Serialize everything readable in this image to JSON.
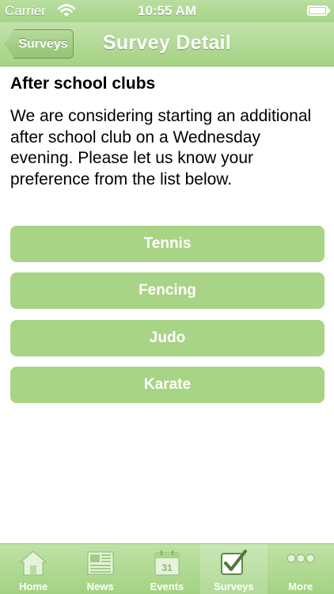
{
  "status_bar": {
    "carrier": "Carrier",
    "time": "10:55 AM"
  },
  "nav": {
    "back_label": "Surveys",
    "title": "Survey Detail"
  },
  "survey": {
    "title": "After school clubs",
    "description": "We are considering starting an additional after school club on a Wednesday evening. Please let us know your preference from the list below.",
    "options": [
      {
        "label": "Tennis"
      },
      {
        "label": "Fencing"
      },
      {
        "label": "Judo"
      },
      {
        "label": "Karate"
      }
    ]
  },
  "tab_bar": {
    "items": [
      {
        "label": "Home",
        "icon": "home-icon"
      },
      {
        "label": "News",
        "icon": "news-icon"
      },
      {
        "label": "Events",
        "icon": "calendar-icon",
        "icon_text": "31"
      },
      {
        "label": "Surveys",
        "icon": "checkbox-icon",
        "selected": true
      },
      {
        "label": "More",
        "icon": "more-icon"
      }
    ]
  },
  "colors": {
    "theme_green": "#a6d387",
    "button_green": "#a8d486",
    "text": "#000000"
  }
}
